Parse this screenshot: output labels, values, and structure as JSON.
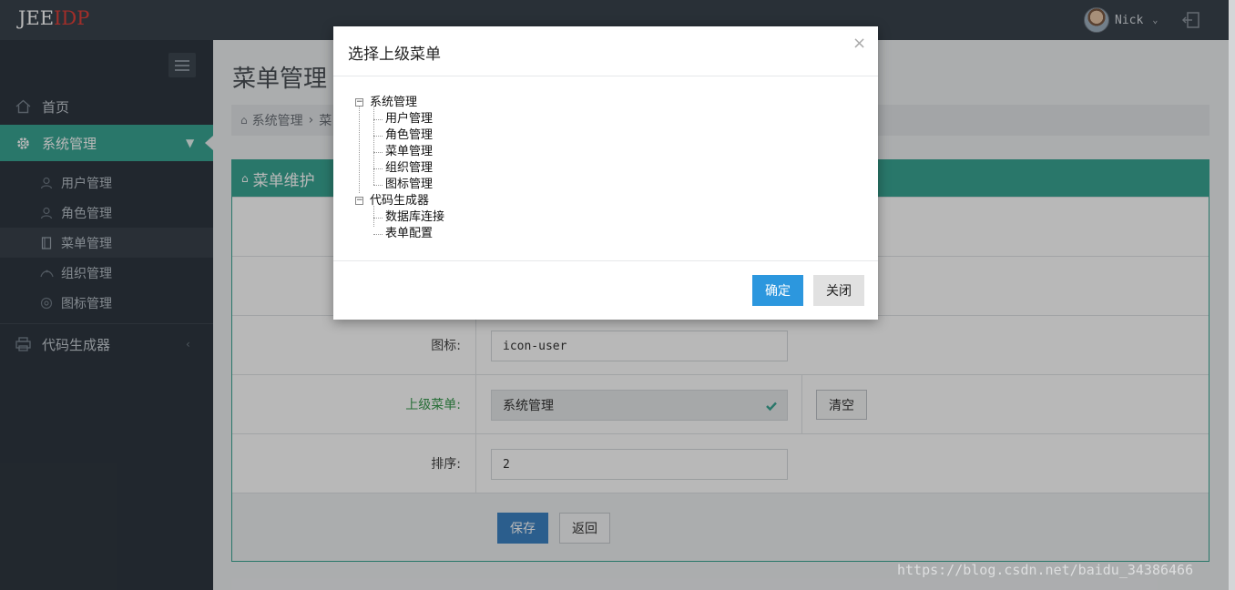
{
  "header": {
    "logo_part1": "JEE",
    "logo_part2": "IDP",
    "user_name": "Nick"
  },
  "sidebar": {
    "items": [
      {
        "label": "首页",
        "icon": "home-icon"
      },
      {
        "label": "系统管理",
        "icon": "gear-icon",
        "active": true
      },
      {
        "label": "代码生成器",
        "icon": "printer-icon"
      }
    ],
    "sub_items": [
      {
        "label": "用户管理",
        "icon": "user-icon"
      },
      {
        "label": "角色管理",
        "icon": "person-icon"
      },
      {
        "label": "菜单管理",
        "icon": "book-icon",
        "current": true
      },
      {
        "label": "组织管理",
        "icon": "org-icon"
      },
      {
        "label": "图标管理",
        "icon": "settings-icon"
      }
    ]
  },
  "main": {
    "page_title": "菜单管理",
    "breadcrumb": {
      "home": "系统管理",
      "sep": "›",
      "current": "菜"
    },
    "panel_title": "菜单维护",
    "form": {
      "icon_label": "图标:",
      "icon_value": "icon-user",
      "parent_label": "上级菜单:",
      "parent_value": "系统管理",
      "clear_label": "清空",
      "order_label": "排序:",
      "order_value": "2"
    },
    "save_label": "保存",
    "back_label": "返回"
  },
  "modal": {
    "title": "选择上级菜单",
    "close_glyph": "×",
    "tree": [
      {
        "label": "系统管理",
        "children": [
          "用户管理",
          "角色管理",
          "菜单管理",
          "组织管理",
          "图标管理"
        ]
      },
      {
        "label": "代码生成器",
        "children": [
          "数据库连接",
          "表单配置"
        ]
      }
    ],
    "ok_label": "确定",
    "close_label": "关闭"
  },
  "watermark": "https://blog.csdn.net/baidu_34386466",
  "colors": {
    "accent": "#3aa593",
    "primary": "#3c83c4",
    "ok": "#2c97de",
    "header": "#3a434d",
    "sidebar": "#2f3740"
  }
}
